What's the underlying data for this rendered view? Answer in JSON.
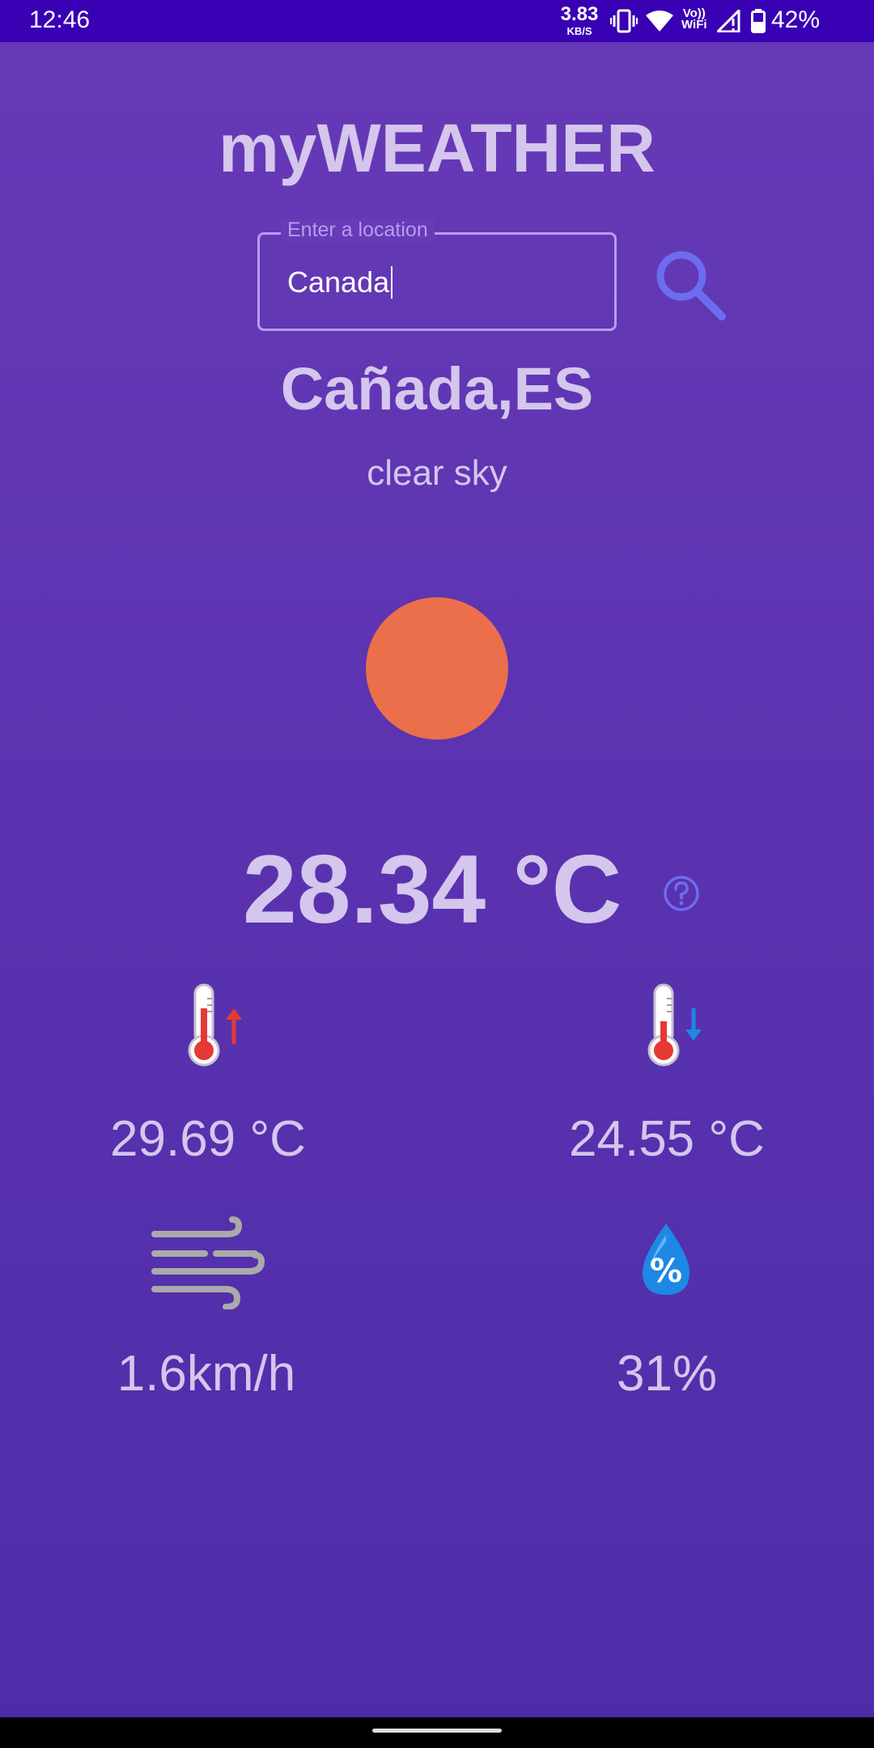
{
  "status_bar": {
    "time": "12:46",
    "network_speed_value": "3.83",
    "network_speed_unit": "KB/S",
    "volte_line1": "Vo))",
    "volte_line2": "WiFi",
    "battery_percent": "42%",
    "icons": [
      "vibrate-icon",
      "wifi-icon",
      "volte-wifi-icon",
      "signal-icon",
      "battery-icon"
    ]
  },
  "app": {
    "title": "myWEATHER"
  },
  "search": {
    "label": "Enter a location",
    "value": "Canada",
    "button_icon": "search-icon"
  },
  "weather": {
    "city": "Cañada,ES",
    "description": "clear sky",
    "icon": "sun-icon",
    "temperature": "28.34 °C",
    "help_icon": "help-icon",
    "max_temp": "29.69 °C",
    "min_temp": "24.55 °C",
    "wind_speed": "1.6km/h",
    "humidity": "31%"
  },
  "colors": {
    "background_top": "#673ab7",
    "background_bottom": "#4e2ca8",
    "status_bar": "#3a00b4",
    "text": "#d4c6ec",
    "accent": "#6c6cf0",
    "sun": "#eb6f4b",
    "field_outline": "#b69df0"
  }
}
